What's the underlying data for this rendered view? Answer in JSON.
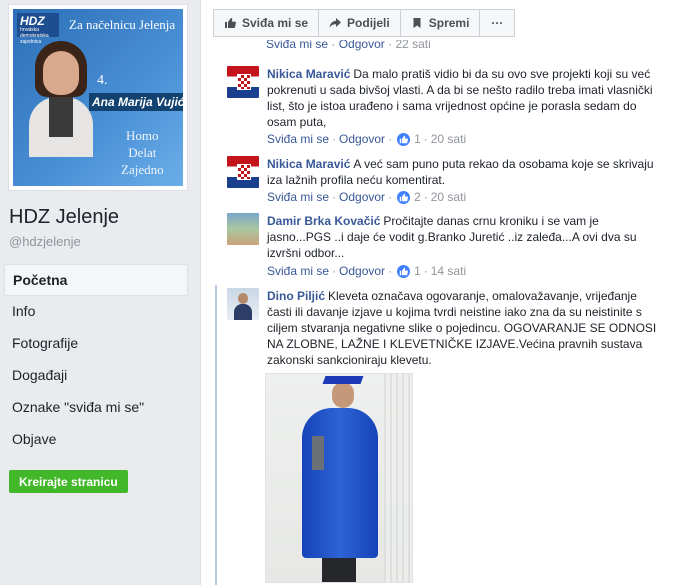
{
  "profile": {
    "cover": {
      "logo_text": "HDZ",
      "logo_subtext": "hrvatska demokratska zajednica",
      "slogan": "Za načelnicu Jelenja",
      "number": "4.",
      "candidate_name": "Ana Marija Vujić",
      "motto_line1": "Homo",
      "motto_line2": "Delat",
      "motto_line3": "Zajedno"
    },
    "page_name": "HDZ Jelenje",
    "handle": "@hdzjelenje"
  },
  "nav": {
    "items": [
      {
        "label": "Početna",
        "active": true
      },
      {
        "label": "Info"
      },
      {
        "label": "Fotografije"
      },
      {
        "label": "Događaji"
      },
      {
        "label": "Oznake \"sviđa mi se\""
      },
      {
        "label": "Objave"
      }
    ],
    "create_page_label": "Kreirajte stranicu"
  },
  "actions": {
    "like": "Sviđa mi se",
    "share": "Podijeli",
    "save": "Spremi",
    "more": "···"
  },
  "comments": {
    "partial_top": {
      "like": "Sviđa mi se",
      "sep": "·",
      "reply": "Odgovor",
      "time": "22 sati"
    },
    "items": [
      {
        "author": "Nikica Maravić",
        "text": "Da malo pratiš vidio bi da su ovo sve projekti koji su već pokrenuti u sada bivšoj vlasti. A da bi se nešto radilo treba imati vlasnički list, što je istoa urađeno i sama vrijednost općine je porasla sedam do osam puta,",
        "like": "Sviđa mi se",
        "reply": "Odgovor",
        "likes": "1",
        "time": "20 sati"
      },
      {
        "author": "Nikica Maravić",
        "text": "A već sam puno puta rekao da osobama koje se skrivaju iza lažnih profila neću komentirat.",
        "like": "Sviđa mi se",
        "reply": "Odgovor",
        "likes": "2",
        "time": "20 sati"
      },
      {
        "author": "Damir Brka Kovačić",
        "text": "Pročitajte danas crnu kroniku i se vam je jasno...PGS ..i daje će vodit g.Branko Juretić ..iz zaleđa...A ovi dva su izvršni odbor...",
        "like": "Sviđa mi se",
        "reply": "Odgovor",
        "likes": "1",
        "time": "14 sati"
      },
      {
        "author": "Dino Piljić",
        "text": "Kleveta označava ogovaranje, omalovažavanje, vrijeđanje časti ili davanje izjave u kojima tvrdi neistine iako zna da su neistinite s ciljem stvaranja negativne slike o pojedincu. OGOVARANJE SE ODNOSI NA ZLOBNE, LAŽNE I KLEVETNIČKE IZJAVE.Većina pravnih sustava zakonski sankcioniraju klevetu."
      }
    ]
  },
  "colors": {
    "link": "#385898",
    "meta": "#90949c",
    "like_badge": "#4080ff",
    "create_button": "#42b72a",
    "background": "#e9ebee"
  }
}
